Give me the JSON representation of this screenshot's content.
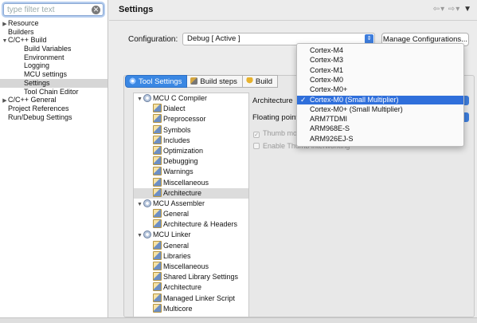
{
  "filter": {
    "placeholder": "type filter text"
  },
  "nav": [
    {
      "label": "Resource",
      "expander": "▶",
      "indent": 0
    },
    {
      "label": "Builders",
      "expander": "",
      "indent": 0
    },
    {
      "label": "C/C++ Build",
      "expander": "▼",
      "indent": 0
    },
    {
      "label": "Build Variables",
      "expander": "",
      "indent": 1
    },
    {
      "label": "Environment",
      "expander": "",
      "indent": 1
    },
    {
      "label": "Logging",
      "expander": "",
      "indent": 1
    },
    {
      "label": "MCU settings",
      "expander": "",
      "indent": 1
    },
    {
      "label": "Settings",
      "expander": "",
      "indent": 1,
      "selected": true
    },
    {
      "label": "Tool Chain Editor",
      "expander": "",
      "indent": 1
    },
    {
      "label": "C/C++ General",
      "expander": "▶",
      "indent": 0
    },
    {
      "label": "Project References",
      "expander": "",
      "indent": 0
    },
    {
      "label": "Run/Debug Settings",
      "expander": "",
      "indent": 0
    }
  ],
  "header": {
    "title": "Settings",
    "back": "⇦",
    "fwd": "⇨",
    "menu": "▼"
  },
  "configuration": {
    "label": "Configuration:",
    "value": "Debug  [ Active ]",
    "manage_button": "Manage Configurations..."
  },
  "tabs": [
    {
      "label": "Tool Settings",
      "icon": "gear",
      "active": true
    },
    {
      "label": "Build steps",
      "icon": "steps"
    },
    {
      "label": "Build",
      "icon": "trophy"
    }
  ],
  "tool_tree": [
    {
      "label": "MCU C Compiler",
      "type": "tool",
      "indent": 0
    },
    {
      "label": "Dialect",
      "type": "option",
      "indent": 1
    },
    {
      "label": "Preprocessor",
      "type": "option",
      "indent": 1
    },
    {
      "label": "Symbols",
      "type": "option",
      "indent": 1
    },
    {
      "label": "Includes",
      "type": "option",
      "indent": 1
    },
    {
      "label": "Optimization",
      "type": "option",
      "indent": 1
    },
    {
      "label": "Debugging",
      "type": "option",
      "indent": 1
    },
    {
      "label": "Warnings",
      "type": "option",
      "indent": 1
    },
    {
      "label": "Miscellaneous",
      "type": "option",
      "indent": 1
    },
    {
      "label": "Architecture",
      "type": "option",
      "indent": 1,
      "selected": true
    },
    {
      "label": "MCU Assembler",
      "type": "tool",
      "indent": 0
    },
    {
      "label": "General",
      "type": "option",
      "indent": 1
    },
    {
      "label": "Architecture & Headers",
      "type": "option",
      "indent": 1
    },
    {
      "label": "MCU Linker",
      "type": "tool",
      "indent": 0
    },
    {
      "label": "General",
      "type": "option",
      "indent": 1
    },
    {
      "label": "Libraries",
      "type": "option",
      "indent": 1
    },
    {
      "label": "Miscellaneous",
      "type": "option",
      "indent": 1
    },
    {
      "label": "Shared Library Settings",
      "type": "option",
      "indent": 1
    },
    {
      "label": "Architecture",
      "type": "option",
      "indent": 1
    },
    {
      "label": "Managed Linker Script",
      "type": "option",
      "indent": 1
    },
    {
      "label": "Multicore",
      "type": "option",
      "indent": 1
    }
  ],
  "settings": {
    "architecture_label": "Architecture",
    "floating_point_label": "Floating point",
    "thumb_label": "Thumb mo",
    "interworking_label": "Enable Thumb interworking",
    "thumb_checked": true,
    "interworking_checked": false
  },
  "architecture_options": [
    {
      "label": "Cortex-M4"
    },
    {
      "label": "Cortex-M3"
    },
    {
      "label": "Cortex-M1"
    },
    {
      "label": "Cortex-M0"
    },
    {
      "label": "Cortex-M0+"
    },
    {
      "label": "Cortex-M0 (Small Multiplier)",
      "selected": true
    },
    {
      "label": "Cortex-M0+ (Small Multiplier)"
    },
    {
      "label": "ARM7TDMI"
    },
    {
      "label": "ARM968E-S"
    },
    {
      "label": "ARM926EJ-S"
    }
  ],
  "colors": {
    "accent": "#3a87e3",
    "selection": "#2f6fdb"
  }
}
